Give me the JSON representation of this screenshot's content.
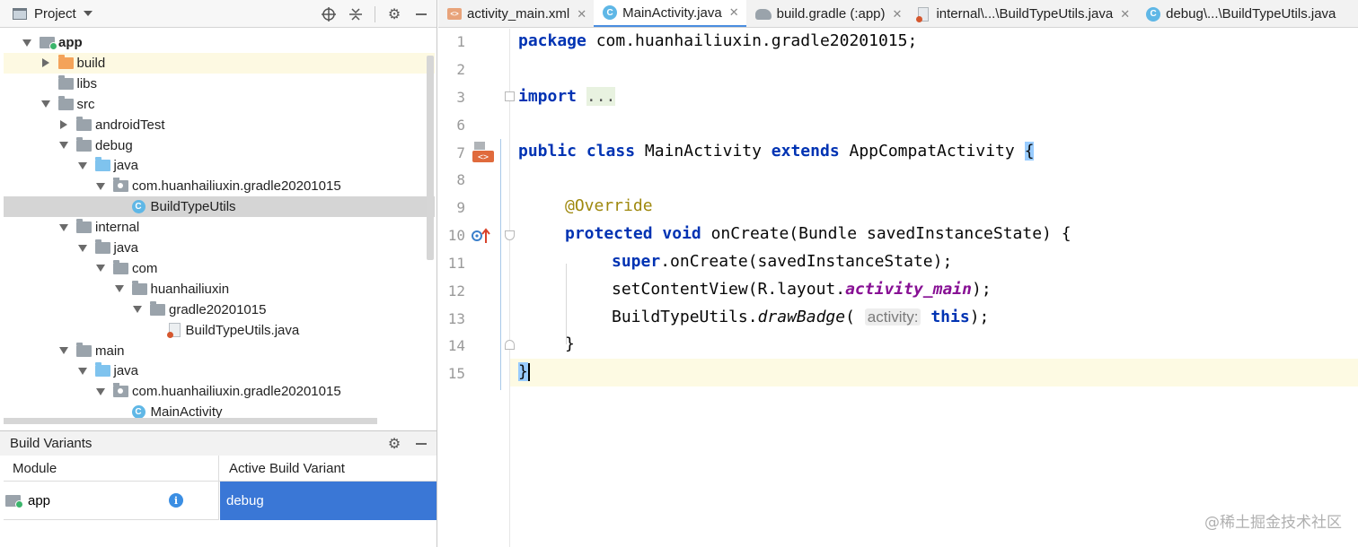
{
  "project_panel": {
    "title": "Project",
    "tree": [
      {
        "label": "app",
        "level": 1,
        "arrow": "down",
        "icon": "module",
        "bold": true
      },
      {
        "label": "build",
        "level": 2,
        "arrow": "right",
        "icon": "folder-orange"
      },
      {
        "label": "libs",
        "level": 2,
        "arrow": "none",
        "icon": "folder-grey"
      },
      {
        "label": "src",
        "level": 2,
        "arrow": "down",
        "icon": "folder-grey"
      },
      {
        "label": "androidTest",
        "level": 3,
        "arrow": "right",
        "icon": "folder-grey"
      },
      {
        "label": "debug",
        "level": 3,
        "arrow": "down",
        "icon": "folder-grey"
      },
      {
        "label": "java",
        "level": 4,
        "arrow": "down",
        "icon": "folder-blue"
      },
      {
        "label": "com.huanhailiuxin.gradle20201015",
        "level": 5,
        "arrow": "down",
        "icon": "package"
      },
      {
        "label": "BuildTypeUtils",
        "level": 6,
        "arrow": "none",
        "icon": "class",
        "selected": true
      },
      {
        "label": "internal",
        "level": 3,
        "arrow": "down",
        "icon": "folder-grey"
      },
      {
        "label": "java",
        "level": 4,
        "arrow": "down",
        "icon": "folder-grey"
      },
      {
        "label": "com",
        "level": 5,
        "arrow": "down",
        "icon": "folder-grey"
      },
      {
        "label": "huanhailiuxin",
        "level": 6,
        "arrow": "down",
        "icon": "folder-grey"
      },
      {
        "label": "gradle20201015",
        "level": 7,
        "arrow": "down",
        "icon": "folder-grey"
      },
      {
        "label": "BuildTypeUtils.java",
        "level": 8,
        "arrow": "none",
        "icon": "java-file"
      },
      {
        "label": "main",
        "level": 3,
        "arrow": "down",
        "icon": "folder-grey"
      },
      {
        "label": "java",
        "level": 4,
        "arrow": "down",
        "icon": "folder-blue"
      },
      {
        "label": "com.huanhailiuxin.gradle20201015",
        "level": 5,
        "arrow": "down",
        "icon": "package"
      },
      {
        "label": "MainActivity",
        "level": 6,
        "arrow": "none",
        "icon": "class"
      }
    ]
  },
  "build_variants": {
    "title": "Build Variants",
    "col_module": "Module",
    "col_variant": "Active Build Variant",
    "rows": [
      {
        "module": "app",
        "variant": "debug"
      }
    ]
  },
  "tabs": [
    {
      "label": "activity_main.xml",
      "icon": "xml-file-icon",
      "active": false
    },
    {
      "label": "MainActivity.java",
      "icon": "class-icon",
      "active": true
    },
    {
      "label": "build.gradle (:app)",
      "icon": "gradle-icon",
      "active": false
    },
    {
      "label": "internal\\...\\BuildTypeUtils.java",
      "icon": "java-file-icon",
      "active": false
    },
    {
      "label": "debug\\...\\BuildTypeUtils.java",
      "icon": "class-icon",
      "active": false
    }
  ],
  "editor": {
    "line_numbers": [
      "1",
      "2",
      "3",
      "6",
      "7",
      "8",
      "9",
      "10",
      "11",
      "12",
      "13",
      "14",
      "15"
    ],
    "code": {
      "l1_kw": "package",
      "l1_rest": " com.huanhailiuxin.gradle20201015;",
      "l3_kw": "import",
      "l3_fold": "...",
      "l7_kw1": "public",
      "l7_kw2": "class",
      "l7_name": "MainActivity",
      "l7_kw3": "extends",
      "l7_super": "AppCompatActivity",
      "l7_brace": "{",
      "l9_ann": "@Override",
      "l10_kw1": "protected",
      "l10_kw2": "void",
      "l10_rest": "onCreate(Bundle savedInstanceState) {",
      "l11_kw": "super",
      "l11_rest": ".onCreate(savedInstanceState);",
      "l12_pre": "setContentView(R.layout.",
      "l12_field": "activity_main",
      "l12_post": ");",
      "l13_pre": "BuildTypeUtils.",
      "l13_method": "drawBadge",
      "l13_paren": "(",
      "l13_hint": "activity:",
      "l13_kw": "this",
      "l13_post": ");",
      "l14": "}",
      "l15_brace": "}"
    }
  },
  "watermark": "@稀土掘金技术社区",
  "colors": {
    "keyword": "#0033b3",
    "annotation": "#9e880d",
    "field": "#871094",
    "selection": "#3a77d6",
    "active_tab_underline": "#4a8de0"
  }
}
